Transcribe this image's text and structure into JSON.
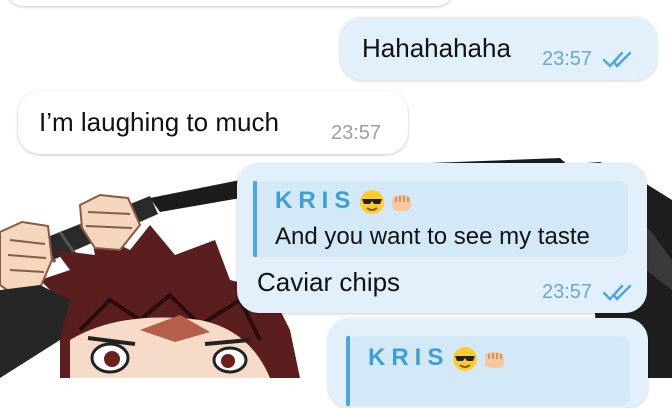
{
  "messages": [
    {
      "direction": "outgoing",
      "text": "Hahahahaha",
      "time": "23:57",
      "status": "read"
    },
    {
      "direction": "incoming",
      "text": "I’m laughing to much",
      "time": "23:57"
    },
    {
      "direction": "outgoing",
      "reply": {
        "author": "KRIS",
        "author_emojis": [
          "smiling-face-with-sunglasses",
          "oncoming-fist"
        ],
        "text": "And you want to see my taste"
      },
      "text": "Caviar chips",
      "time": "23:57",
      "status": "read"
    },
    {
      "direction": "outgoing",
      "reply": {
        "author": "KRIS",
        "author_emojis": [
          "smiling-face-with-sunglasses",
          "oncoming-fist"
        ]
      }
    }
  ],
  "colors": {
    "outgoing_bubble": "#e1f0fb",
    "incoming_bubble": "#ffffff",
    "reply_accent": "#4ea4dc",
    "timestamp": "#9aa0a6",
    "read_check": "#4ea4dc"
  },
  "wallpaper": "anime character with sword sticker"
}
